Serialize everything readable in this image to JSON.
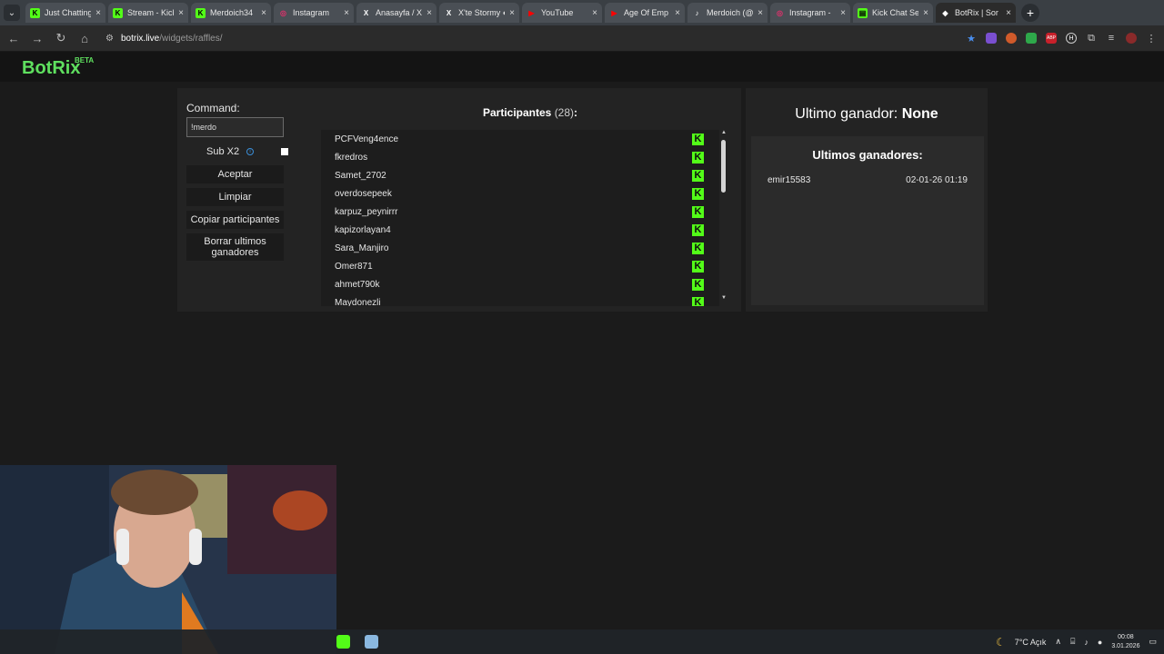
{
  "browser": {
    "tabs": [
      {
        "title": "Just Chatting",
        "favicon": "kick-icon",
        "color": "#53fc18",
        "letter": "K"
      },
      {
        "title": "Stream - Kick",
        "favicon": "kick-icon",
        "color": "#53fc18",
        "letter": "K"
      },
      {
        "title": "Merdoich34",
        "favicon": "kick-icon",
        "color": "#53fc18",
        "letter": "K"
      },
      {
        "title": "Instagram",
        "favicon": "instagram-icon",
        "color": "#e1306c",
        "letter": "◎"
      },
      {
        "title": "Anasayfa / X",
        "favicon": "x-icon",
        "color": "#ffffff",
        "letter": "X"
      },
      {
        "title": "X'te Stormy ●",
        "favicon": "x-icon",
        "color": "#ffffff",
        "letter": "X"
      },
      {
        "title": "YouTube",
        "favicon": "youtube-icon",
        "color": "#ff0000",
        "letter": "▶"
      },
      {
        "title": "Age Of Emp",
        "favicon": "youtube-icon",
        "color": "#ff0000",
        "letter": "▶"
      },
      {
        "title": "Merdoich (@",
        "favicon": "tiktok-icon",
        "color": "#ffffff",
        "letter": "♪"
      },
      {
        "title": "Instagram -",
        "favicon": "instagram-icon",
        "color": "#e1306c",
        "letter": "◎"
      },
      {
        "title": "Kick Chat Se",
        "favicon": "chat-icon",
        "color": "#53fc18",
        "letter": "▤"
      },
      {
        "title": "BotRix | Sor",
        "favicon": "botrix-icon",
        "color": "#ffffff",
        "letter": "◆"
      }
    ],
    "url_host": "botrix.live",
    "url_path": "/widgets/raffles/"
  },
  "app": {
    "logo": "BotRix",
    "beta": "BETA"
  },
  "controls": {
    "command_label": "Command:",
    "command_value": "!merdo",
    "sub_x2_label": "Sub X2",
    "accept_label": "Aceptar",
    "clear_label": "Limpiar",
    "copy_label": "Copiar participantes",
    "delete_label": "Borrar ultimos ganadores"
  },
  "participants": {
    "title": "Participantes",
    "count": "(28)",
    "colon": ":",
    "list": [
      "PCFVeng4ence",
      "fkredros",
      "Samet_2702",
      "overdosepeek",
      "karpuz_peynirrr",
      "kapizorlayan4",
      "Sara_Manjiro",
      "Omer871",
      "ahmet790k",
      "Maydonezli"
    ]
  },
  "winners": {
    "last_label": "Ultimo ganador:",
    "last_value": "None",
    "list_title": "Ultimos ganadores:",
    "rows": [
      {
        "name": "emir15583",
        "date": "02-01-26 01:19"
      }
    ]
  },
  "taskbar": {
    "weather": "7°C  Açık",
    "time": "00:08",
    "date": "3.01.2026"
  }
}
